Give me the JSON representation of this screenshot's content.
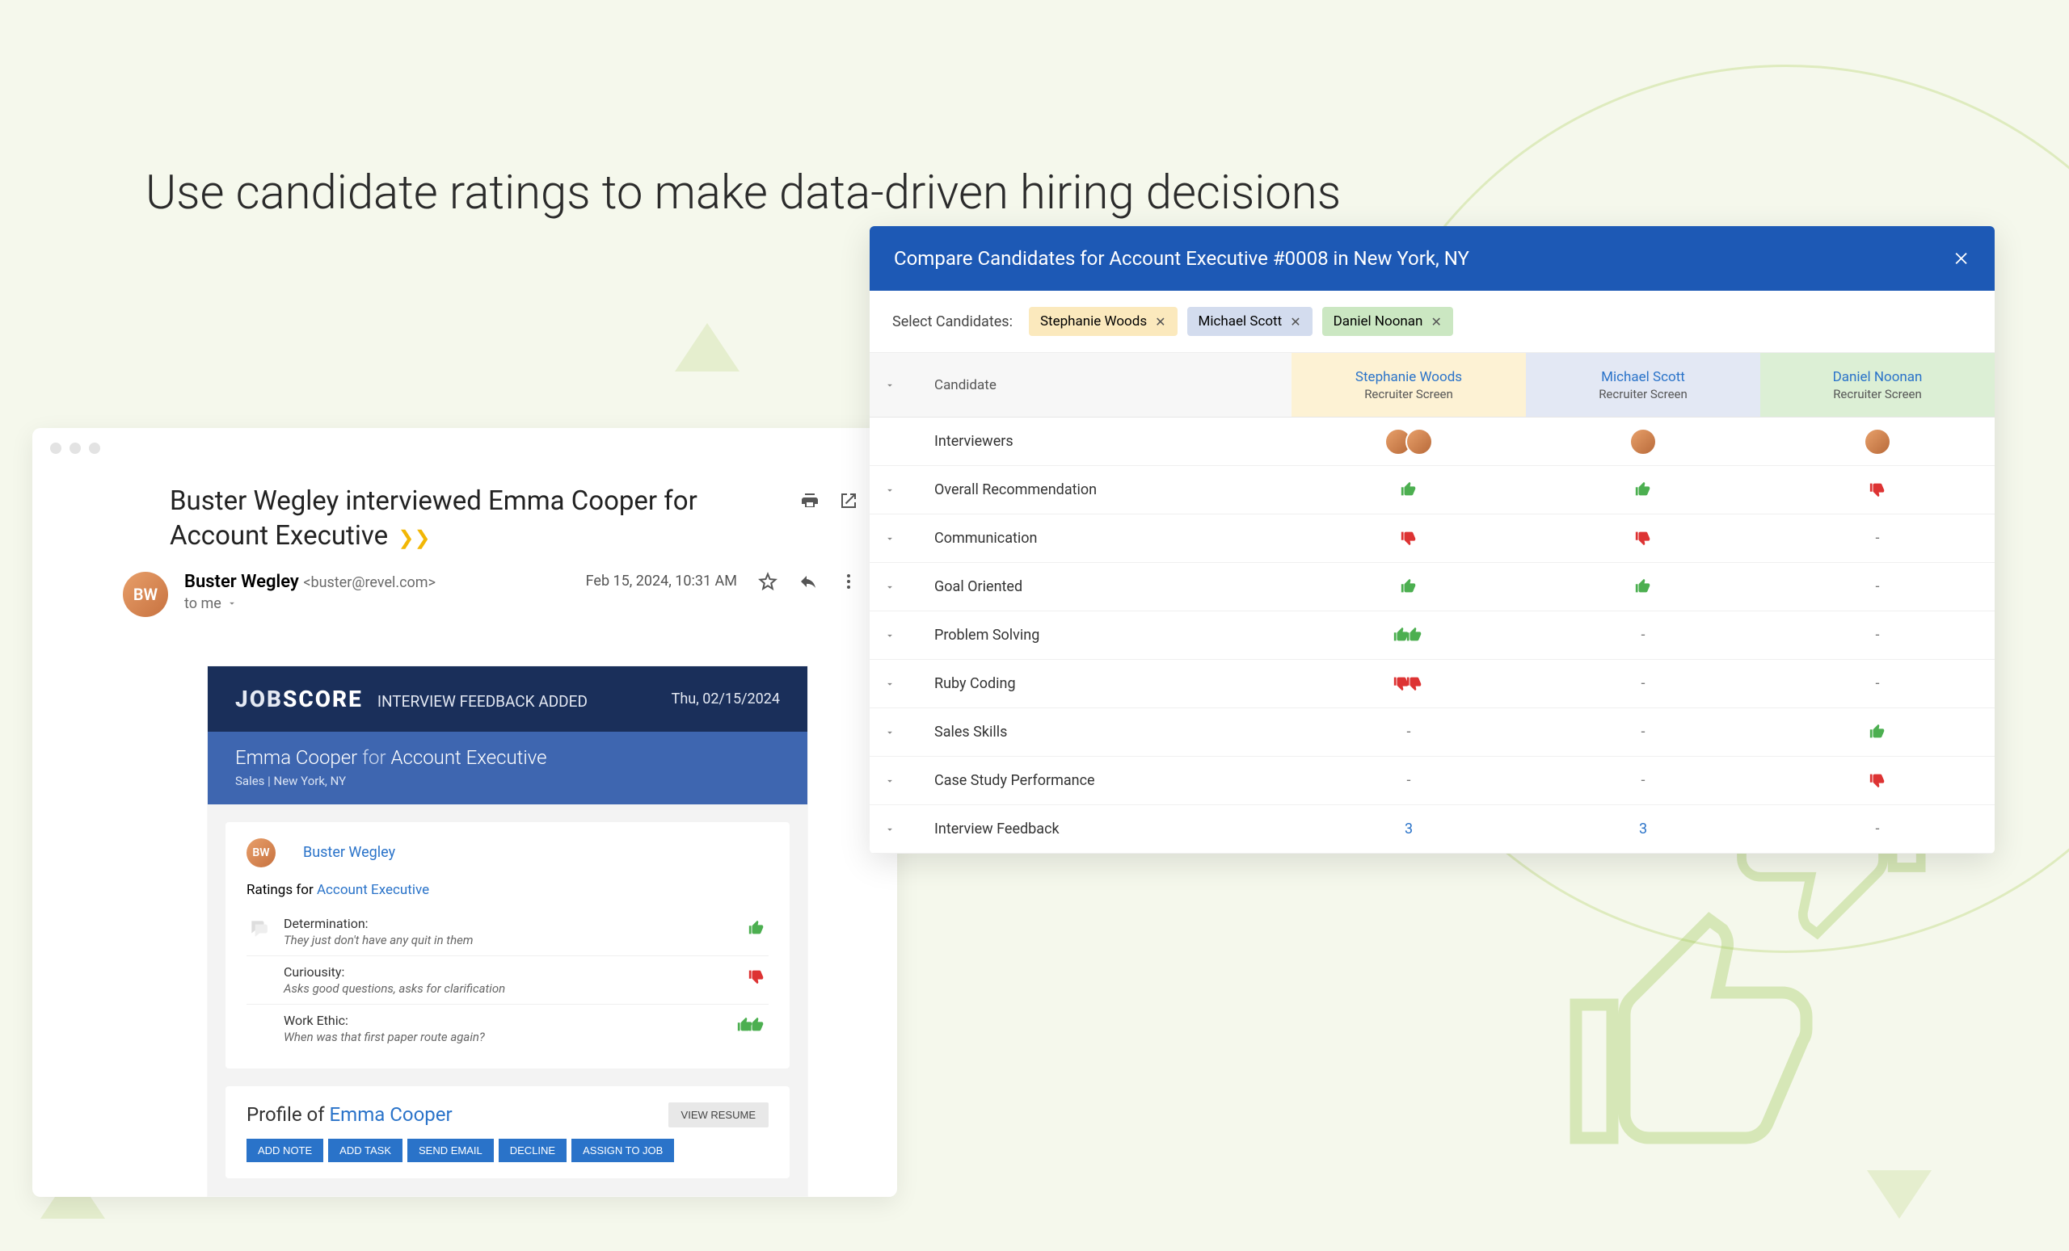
{
  "headline": "Use candidate ratings to make data-driven hiring decisions",
  "email": {
    "subject_person": "Buster Wegley",
    "subject_verb": " interviewed ",
    "subject_candidate": "Emma Cooper",
    "subject_role": " for Account Executive",
    "sender_name": "Buster Wegley",
    "sender_email": "<buster@revel.com>",
    "to_line": "to me",
    "timestamp": "Feb 15, 2024, 10:31 AM"
  },
  "feedback": {
    "logo_prefix": "JOB",
    "logo_suffix": "SCORE",
    "label": "INTERVIEW FEEDBACK ADDED",
    "date": "Thu, 02/15/2024",
    "candidate": "Emma Cooper",
    "for_word": " for ",
    "role": "Account Executive",
    "location": "Sales | New York, NY",
    "reviewer": "Buster Wegley",
    "ratings_prefix": "Ratings for ",
    "ratings_link": "Account Executive",
    "rows": [
      {
        "title": "Determination:",
        "desc": "They just don't have any quit in them",
        "rating": "up"
      },
      {
        "title": "Curiousity:",
        "desc": "Asks good questions, asks for clarification",
        "rating": "down"
      },
      {
        "title": "Work Ethic:",
        "desc": "When was that first paper route again?",
        "rating": "dbl-up"
      }
    ],
    "profile_prefix": "Profile of ",
    "profile_link": "Emma Cooper",
    "view_resume": "VIEW RESUME",
    "actions": [
      "ADD NOTE",
      "ADD TASK",
      "SEND EMAIL",
      "DECLINE",
      "ASSIGN TO JOB"
    ]
  },
  "compare": {
    "title": "Compare Candidates for Account Executive #0008 in New York, NY",
    "select_label": "Select Candidates:",
    "candidates": [
      {
        "name": "Stephanie Woods",
        "stage": "Recruiter Screen"
      },
      {
        "name": "Michael Scott",
        "stage": "Recruiter Screen"
      },
      {
        "name": "Daniel Noonan",
        "stage": "Recruiter Screen"
      }
    ],
    "row_candidate_label": "Candidate",
    "row_interviewers_label": "Interviewers",
    "interviewers": [
      {
        "count": 2
      },
      {
        "count": 1
      },
      {
        "count": 1
      }
    ],
    "criteria": [
      {
        "label": "Overall Recommendation",
        "cells": [
          "up",
          "up",
          "down"
        ]
      },
      {
        "label": "Communication",
        "cells": [
          "down",
          "down",
          "-"
        ]
      },
      {
        "label": "Goal Oriented",
        "cells": [
          "up",
          "up",
          "-"
        ]
      },
      {
        "label": "Problem Solving",
        "cells": [
          "dbl-up",
          "-",
          "-"
        ]
      },
      {
        "label": "Ruby Coding",
        "cells": [
          "dbl-down",
          "-",
          "-"
        ]
      },
      {
        "label": "Sales Skills",
        "cells": [
          "-",
          "-",
          "up"
        ]
      },
      {
        "label": "Case Study Performance",
        "cells": [
          "-",
          "-",
          "down"
        ]
      },
      {
        "label": "Interview Feedback",
        "cells": [
          "3",
          "3",
          "-"
        ],
        "numeric": true
      }
    ]
  }
}
